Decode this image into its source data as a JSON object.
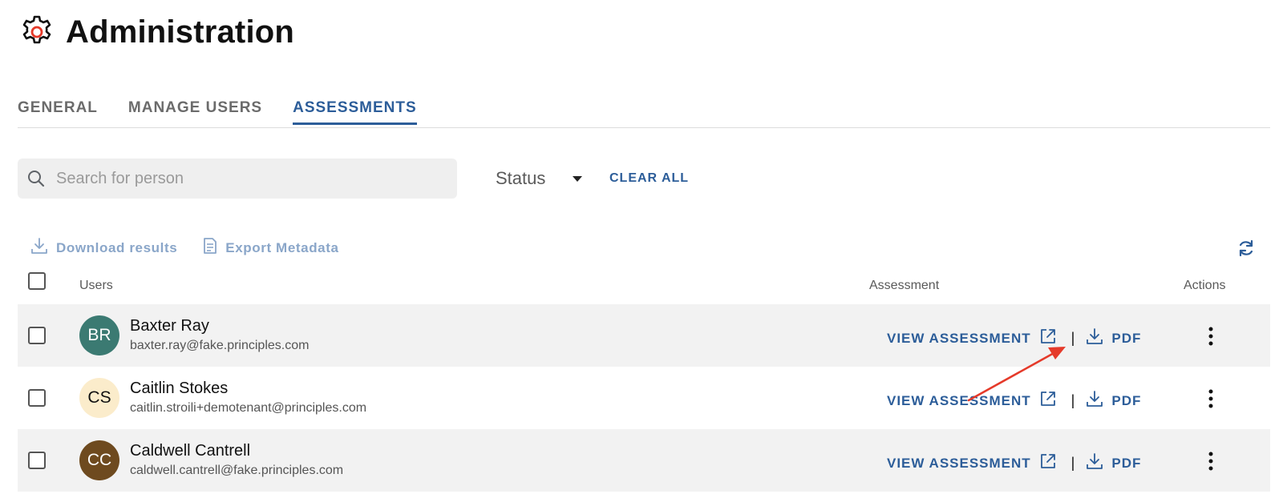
{
  "header": {
    "title": "Administration",
    "icon": "gear-icon",
    "icon_accent": "#e53a2a"
  },
  "tabs": [
    {
      "label": "GENERAL",
      "active": false
    },
    {
      "label": "MANAGE USERS",
      "active": false
    },
    {
      "label": "ASSESSMENTS",
      "active": true
    }
  ],
  "filters": {
    "search_placeholder": "Search for person",
    "search_value": "",
    "status_label": "Status",
    "clear_all": "CLEAR ALL"
  },
  "toolbar": {
    "download_results": "Download results",
    "export_metadata": "Export Metadata"
  },
  "table": {
    "columns": {
      "users": "Users",
      "assessment": "Assessment",
      "actions": "Actions"
    },
    "rows": [
      {
        "initials": "BR",
        "name": "Baxter Ray",
        "email": "baxter.ray@fake.principles.com",
        "avatar_bg": "#3b7a72",
        "avatar_fg": "#ffffff",
        "view_label": "VIEW ASSESSMENT",
        "separator": "|",
        "pdf_label": "PDF"
      },
      {
        "initials": "CS",
        "name": "Caitlin Stokes",
        "email": "caitlin.stroili+demotenant@principles.com",
        "avatar_bg": "#fbeccb",
        "avatar_fg": "#111111",
        "view_label": "VIEW ASSESSMENT",
        "separator": "|",
        "pdf_label": "PDF"
      },
      {
        "initials": "CC",
        "name": "Caldwell Cantrell",
        "email": "caldwell.cantrell@fake.principles.com",
        "avatar_bg": "#6e4a1f",
        "avatar_fg": "#ffffff",
        "view_label": "VIEW ASSESSMENT",
        "separator": "|",
        "pdf_label": "PDF"
      }
    ]
  },
  "colors": {
    "accent": "#2c5d99",
    "muted_accent": "#8aa6c9",
    "annotation_arrow": "#e53a2a"
  }
}
